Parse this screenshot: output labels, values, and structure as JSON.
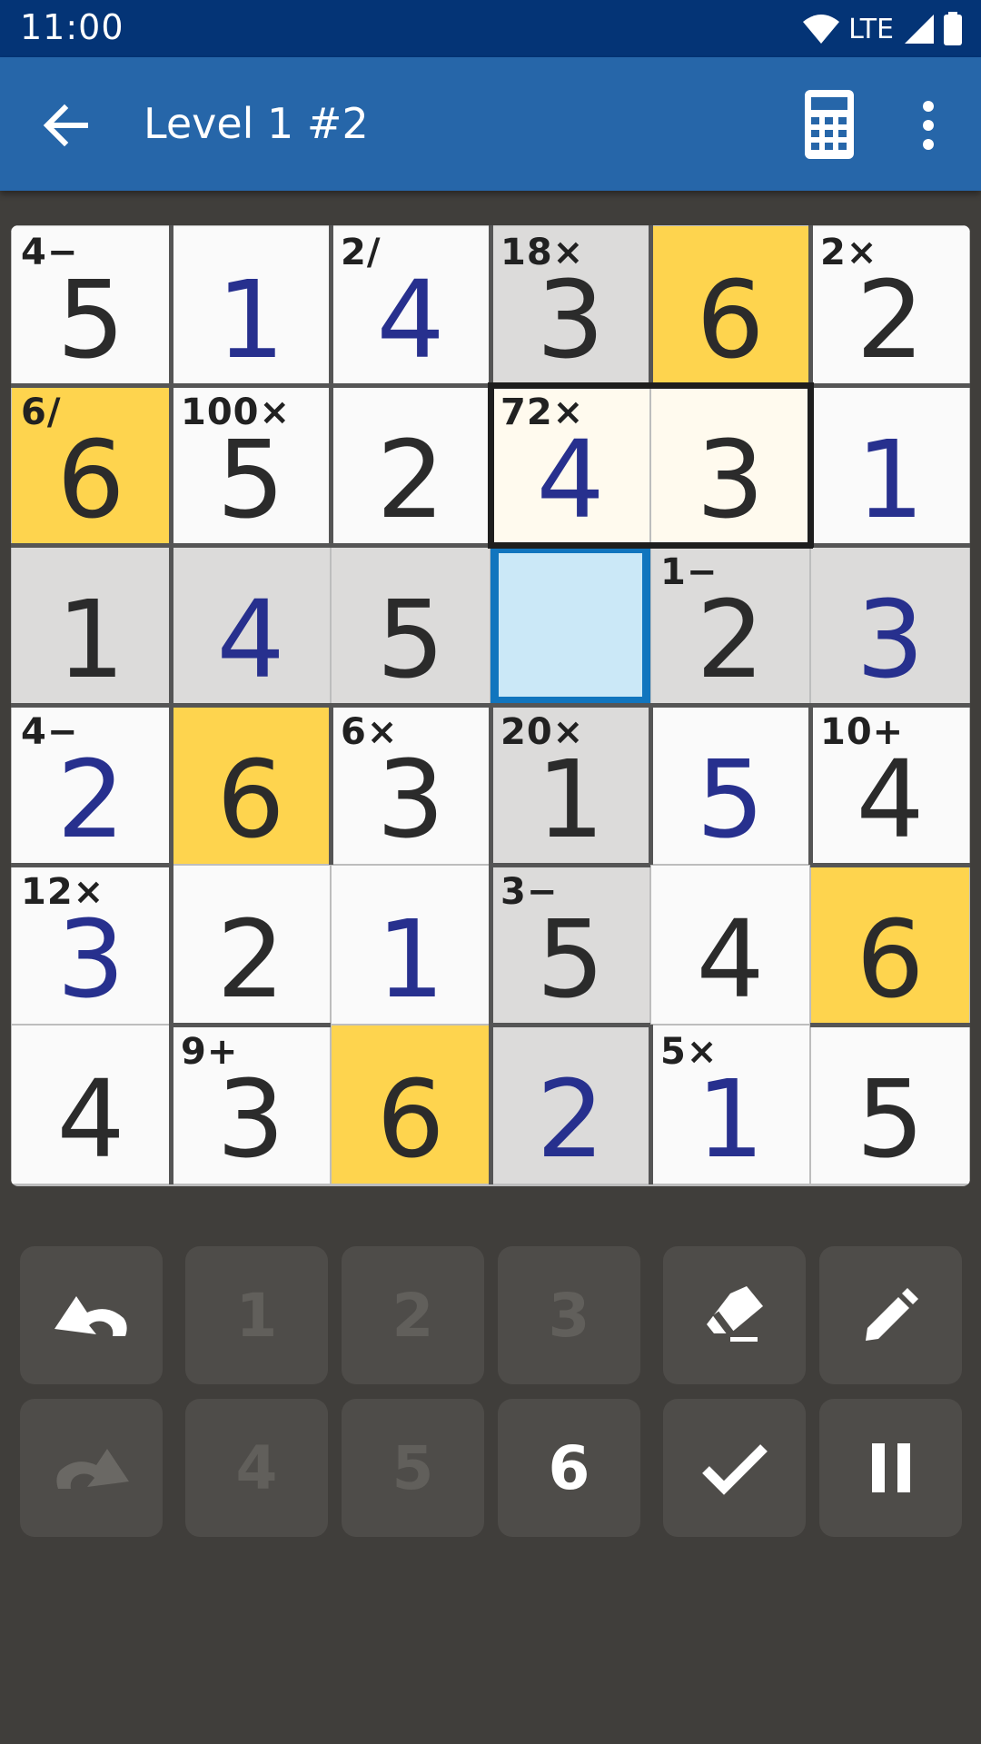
{
  "status_bar": {
    "time": "11:00",
    "network": "LTE"
  },
  "app_bar": {
    "title": "Level 1 #2",
    "icons": [
      "back-arrow-icon",
      "calculator-icon",
      "overflow-menu-icon"
    ]
  },
  "colors": {
    "status_bar": "#043476",
    "app_bar": "#2666a9",
    "background": "#403e3b",
    "cell_white": "#fafafa",
    "cell_gray": "#dcdbda",
    "cell_yellow": "#fed44e",
    "cell_highlight": "#fffaee",
    "cell_selected": "#cbe8f7",
    "selection_border": "#1175be",
    "given_digit": "#2b2b2b",
    "entered_digit": "#27308e"
  },
  "grid": {
    "size": 6,
    "cells": [
      [
        {
          "v": "5",
          "u": false,
          "c": "white",
          "l": "4−"
        },
        {
          "v": "1",
          "u": true,
          "c": "white"
        },
        {
          "v": "4",
          "u": true,
          "c": "white",
          "l": "2/"
        },
        {
          "v": "3",
          "u": false,
          "c": "gray",
          "l": "18×"
        },
        {
          "v": "6",
          "u": false,
          "c": "yellow"
        },
        {
          "v": "2",
          "u": false,
          "c": "white",
          "l": "2×"
        }
      ],
      [
        {
          "v": "6",
          "u": false,
          "c": "yellow",
          "l": "6/"
        },
        {
          "v": "5",
          "u": false,
          "c": "white",
          "l": "100×"
        },
        {
          "v": "2",
          "u": false,
          "c": "white"
        },
        {
          "v": "4",
          "u": true,
          "c": "cream",
          "l": "72×"
        },
        {
          "v": "3",
          "u": false,
          "c": "cream"
        },
        {
          "v": "1",
          "u": true,
          "c": "white"
        }
      ],
      [
        {
          "v": "1",
          "u": false,
          "c": "gray"
        },
        {
          "v": "4",
          "u": true,
          "c": "gray"
        },
        {
          "v": "5",
          "u": false,
          "c": "gray"
        },
        {
          "v": "",
          "u": false,
          "c": "selected"
        },
        {
          "v": "2",
          "u": false,
          "c": "gray",
          "l": "1−"
        },
        {
          "v": "3",
          "u": true,
          "c": "gray"
        }
      ],
      [
        {
          "v": "2",
          "u": true,
          "c": "white",
          "l": "4−"
        },
        {
          "v": "6",
          "u": false,
          "c": "yellow"
        },
        {
          "v": "3",
          "u": false,
          "c": "white",
          "l": "6×"
        },
        {
          "v": "1",
          "u": false,
          "c": "gray",
          "l": "20×"
        },
        {
          "v": "5",
          "u": true,
          "c": "white"
        },
        {
          "v": "4",
          "u": false,
          "c": "white",
          "l": "10+"
        }
      ],
      [
        {
          "v": "3",
          "u": true,
          "c": "white",
          "l": "12×"
        },
        {
          "v": "2",
          "u": false,
          "c": "white"
        },
        {
          "v": "1",
          "u": true,
          "c": "white"
        },
        {
          "v": "5",
          "u": false,
          "c": "gray",
          "l": "3−"
        },
        {
          "v": "4",
          "u": false,
          "c": "white"
        },
        {
          "v": "6",
          "u": false,
          "c": "yellow"
        }
      ],
      [
        {
          "v": "4",
          "u": false,
          "c": "white"
        },
        {
          "v": "3",
          "u": false,
          "c": "white",
          "l": "9+"
        },
        {
          "v": "6",
          "u": false,
          "c": "yellow"
        },
        {
          "v": "2",
          "u": true,
          "c": "gray"
        },
        {
          "v": "1",
          "u": true,
          "c": "white",
          "l": "5×"
        },
        {
          "v": "5",
          "u": false,
          "c": "white"
        }
      ]
    ]
  },
  "keypad": {
    "keys": [
      {
        "name": "undo-button",
        "icon": "undo-icon",
        "enabled": true
      },
      {
        "name": "digit-1-button",
        "label": "1",
        "enabled": false
      },
      {
        "name": "digit-2-button",
        "label": "2",
        "enabled": false
      },
      {
        "name": "digit-3-button",
        "label": "3",
        "enabled": false
      },
      {
        "name": "eraser-button",
        "icon": "eraser-icon",
        "enabled": true
      },
      {
        "name": "pencil-button",
        "icon": "pencil-icon",
        "enabled": true
      },
      {
        "name": "redo-button",
        "icon": "redo-icon",
        "enabled": false
      },
      {
        "name": "digit-4-button",
        "label": "4",
        "enabled": false
      },
      {
        "name": "digit-5-button",
        "label": "5",
        "enabled": false
      },
      {
        "name": "digit-6-button",
        "label": "6",
        "enabled": true
      },
      {
        "name": "check-button",
        "icon": "check-icon",
        "enabled": true
      },
      {
        "name": "pause-button",
        "icon": "pause-icon",
        "enabled": true
      }
    ]
  }
}
